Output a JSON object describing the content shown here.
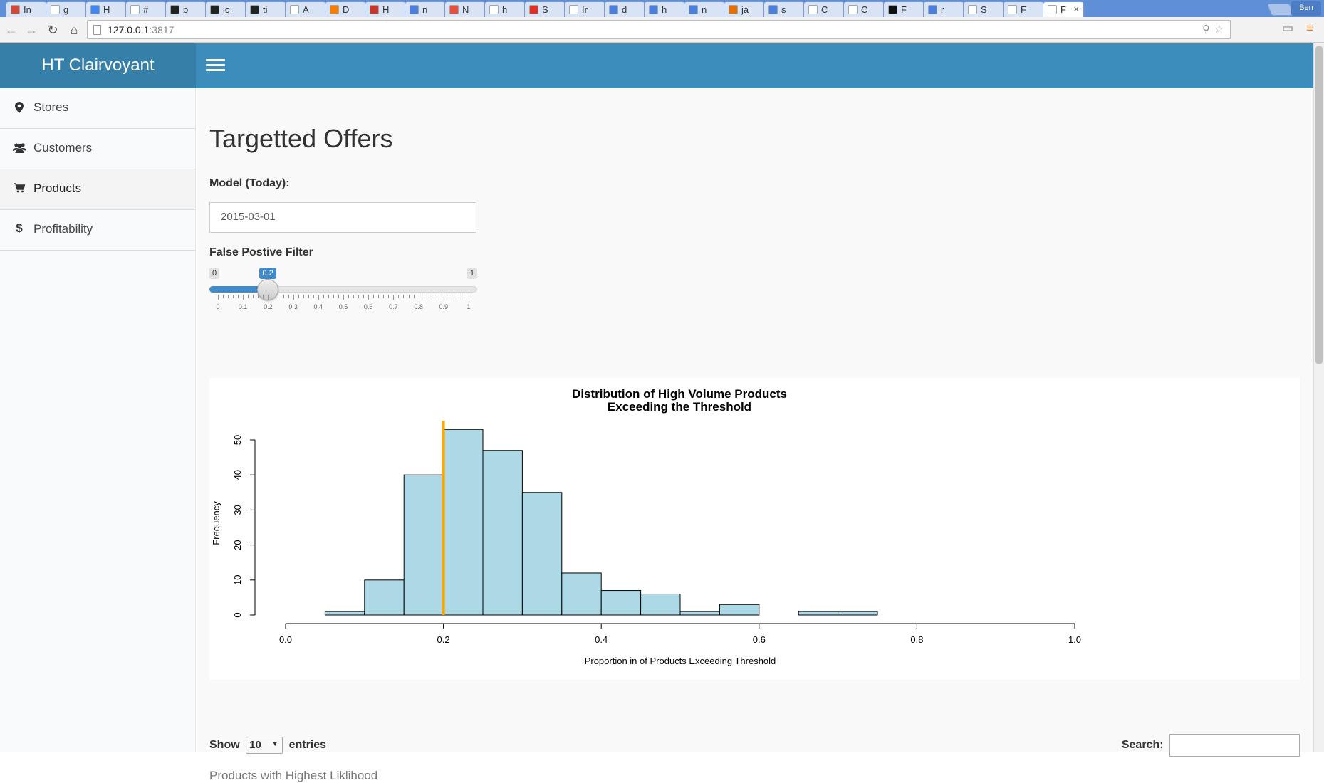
{
  "browser": {
    "tabs": [
      {
        "label": "In",
        "icon": "gmail-icon",
        "color": "#d14836"
      },
      {
        "label": "g",
        "icon": "page-icon",
        "color": "#ffffff"
      },
      {
        "label": "H",
        "icon": "docs-icon",
        "color": "#4285f4"
      },
      {
        "label": "#",
        "icon": "page-icon",
        "color": "#ffffff"
      },
      {
        "label": "b",
        "icon": "github-icon",
        "color": "#222222"
      },
      {
        "label": "ic",
        "icon": "github-icon",
        "color": "#222222"
      },
      {
        "label": "ti",
        "icon": "github-icon",
        "color": "#222222"
      },
      {
        "label": "A",
        "icon": "page-icon",
        "color": "#ffffff"
      },
      {
        "label": "D",
        "icon": "blogger-icon",
        "color": "#f57d00"
      },
      {
        "label": "H",
        "icon": "ruby-icon",
        "color": "#cc342d"
      },
      {
        "label": "n",
        "icon": "google-icon",
        "color": "#4a7fe0"
      },
      {
        "label": "N",
        "icon": "pinwheel-icon",
        "color": "#e94e3c"
      },
      {
        "label": "h",
        "icon": "page-icon",
        "color": "#ffffff"
      },
      {
        "label": "S",
        "icon": "youtube-icon",
        "color": "#e52d27"
      },
      {
        "label": "Ir",
        "icon": "page-icon",
        "color": "#ffffff"
      },
      {
        "label": "d",
        "icon": "google-icon",
        "color": "#4a7fe0"
      },
      {
        "label": "h",
        "icon": "google-icon",
        "color": "#4a7fe0"
      },
      {
        "label": "n",
        "icon": "google-icon",
        "color": "#4a7fe0"
      },
      {
        "label": "ja",
        "icon": "java-icon",
        "color": "#e76f00"
      },
      {
        "label": "s",
        "icon": "google-icon",
        "color": "#4a7fe0"
      },
      {
        "label": "C",
        "icon": "page-icon",
        "color": "#ffffff"
      },
      {
        "label": "C",
        "icon": "page-icon",
        "color": "#ffffff"
      },
      {
        "label": "F",
        "icon": "film-icon",
        "color": "#111111"
      },
      {
        "label": "r",
        "icon": "google-icon",
        "color": "#4a7fe0"
      },
      {
        "label": "S",
        "icon": "page-icon",
        "color": "#ffffff"
      },
      {
        "label": "F",
        "icon": "page-icon",
        "color": "#ffffff"
      },
      {
        "label": "F",
        "icon": "page-icon",
        "color": "#ffffff",
        "active": true
      }
    ],
    "profile": "Ben",
    "url_host": "127.0.0.1",
    "url_port": ":3817"
  },
  "header": {
    "title": "HT Clairvoyant",
    "brand_color": "#3c8dbc"
  },
  "sidebar": {
    "items": [
      {
        "label": "Stores",
        "icon": "map-marker-icon"
      },
      {
        "label": "Customers",
        "icon": "users-icon"
      },
      {
        "label": "Products",
        "icon": "shopping-cart-icon",
        "active": true
      },
      {
        "label": "Profitability",
        "icon": "dollar-icon"
      }
    ]
  },
  "main": {
    "title": "Targetted Offers",
    "model_label": "Model (Today):",
    "model_value": "2015-03-01",
    "filter_label": "False Postive Filter",
    "slider": {
      "min": 0,
      "max": 1,
      "value": 0.2,
      "min_label": "0",
      "max_label": "1",
      "value_label": "0.2",
      "ticks": [
        "0",
        "0.1",
        "0.2",
        "0.3",
        "0.4",
        "0.5",
        "0.6",
        "0.7",
        "0.8",
        "0.9",
        "1"
      ]
    },
    "table": {
      "show_label": "Show",
      "entries_value": "10",
      "entries_label": "entries",
      "search_label": "Search:",
      "caption": "Products with Highest Liklihood"
    }
  },
  "chart_data": {
    "type": "bar",
    "title": "Distribution of High Volume Products",
    "subtitle": "Exceeding the Threshold",
    "xlabel": "Proportion in of Products Exceeding Threshold",
    "ylabel": "Frequency",
    "bin_edges": [
      0.05,
      0.1,
      0.15,
      0.2,
      0.25,
      0.3,
      0.35,
      0.4,
      0.45,
      0.5,
      0.55,
      0.6,
      0.65,
      0.7,
      0.75
    ],
    "values": [
      1,
      10,
      40,
      53,
      47,
      35,
      12,
      7,
      6,
      1,
      3,
      0,
      1,
      1
    ],
    "xlim": [
      0.0,
      1.0
    ],
    "ylim": [
      0,
      50
    ],
    "x_ticks": [
      "0.0",
      "0.2",
      "0.4",
      "0.6",
      "0.8",
      "1.0"
    ],
    "y_ticks": [
      "0",
      "10",
      "20",
      "30",
      "40",
      "50"
    ],
    "threshold": 0.2,
    "bar_color": "#add8e6",
    "threshold_color": "#ffa500",
    "grid": false,
    "legend": false
  }
}
